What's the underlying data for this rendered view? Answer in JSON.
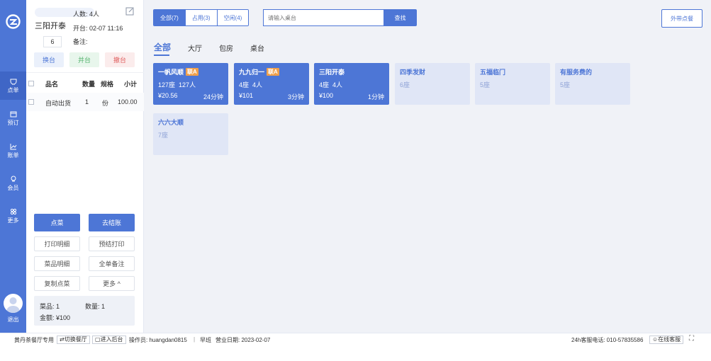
{
  "nav": {
    "logo": "app-logo",
    "items": [
      {
        "label": "点单",
        "icon": "cup-icon",
        "active": true
      },
      {
        "label": "预订",
        "icon": "calendar-icon",
        "active": false
      },
      {
        "label": "账单",
        "icon": "chart-icon",
        "active": false
      },
      {
        "label": "会员",
        "icon": "member-icon",
        "active": false
      },
      {
        "label": "更多",
        "icon": "grid-icon",
        "active": false
      }
    ],
    "exit_label": "退出"
  },
  "table_info": {
    "name": "三阳开泰",
    "guests": "人数: 4人",
    "open_time": "开台: 02-07 11:16",
    "remark": "备注:",
    "count_input": "6"
  },
  "table_actions": {
    "swap": "换台",
    "merge": "并台",
    "cancel": "撤台"
  },
  "order_table": {
    "headers": [
      "品名",
      "数量",
      "规格",
      "小计"
    ],
    "rows": [
      {
        "name": "自动出货",
        "qty": "1",
        "unit": "份",
        "subtotal": "100.00"
      }
    ]
  },
  "order_buttons": {
    "order": "点菜",
    "checkout": "去结账",
    "print_detail": "打印明细",
    "pre_print": "预结打印",
    "dish_detail": "菜品明细",
    "all_remark": "全单备注",
    "copy_order": "复制点菜",
    "more": "更多 ^"
  },
  "summary": {
    "dishes": "菜品: 1",
    "quantity": "数量: 1",
    "amount": "金额: ¥100"
  },
  "filter": {
    "tabs": [
      {
        "label": "全部(7)",
        "active": true
      },
      {
        "label": "占用(3)",
        "active": false
      },
      {
        "label": "空闲(4)",
        "active": false
      }
    ],
    "search_placeholder": "请输入桌台",
    "search_button": "查找",
    "takeout": "外带点餐"
  },
  "areas": [
    {
      "label": "全部",
      "active": true
    },
    {
      "label": "大厅",
      "active": false
    },
    {
      "label": "包房",
      "active": false
    },
    {
      "label": "桌台",
      "active": false
    }
  ],
  "tables": [
    {
      "name": "一帆风顺",
      "badge": "联A",
      "seats": "127座",
      "people": "127人",
      "amount": "¥20.56",
      "duration": "24分钟",
      "status": "busy"
    },
    {
      "name": "九九归一",
      "badge": "联A",
      "seats": "4座",
      "people": "4人",
      "amount": "¥101",
      "duration": "3分钟",
      "status": "busy"
    },
    {
      "name": "三阳开泰",
      "badge": "",
      "seats": "4座",
      "people": "4人",
      "amount": "¥100",
      "duration": "1分钟",
      "status": "busy"
    },
    {
      "name": "四季发财",
      "badge": "",
      "seats": "6座",
      "people": "",
      "amount": "",
      "duration": "",
      "status": "free"
    },
    {
      "name": "五福临门",
      "badge": "",
      "seats": "5座",
      "people": "",
      "amount": "",
      "duration": "",
      "status": "free"
    },
    {
      "name": "有服务费的",
      "badge": "",
      "seats": "5座",
      "people": "",
      "amount": "",
      "duration": "",
      "status": "free"
    },
    {
      "name": "六六大顺",
      "badge": "",
      "seats": "7座",
      "people": "",
      "amount": "",
      "duration": "",
      "status": "free"
    }
  ],
  "footer": {
    "store": "黄丹茶餐厅专用",
    "switch": "切换餐厅",
    "backend": "进入后台",
    "operator": "操作员: huangdan0815",
    "shift": "早班",
    "biz_date": "营业日期: 2023-02-07",
    "hotline": "24h客服电话: 010-57835586",
    "online": "在线客服"
  },
  "colors": {
    "brand": "#4d76d6",
    "free_card": "#e0e6f6",
    "badge": "#f0a04b"
  }
}
